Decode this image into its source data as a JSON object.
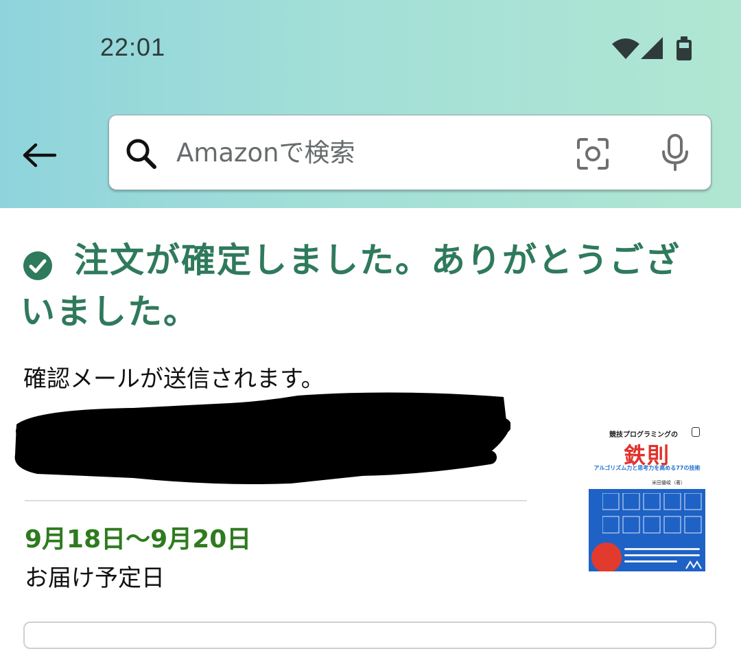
{
  "status_bar": {
    "time": "22:01",
    "icons": [
      "wifi-icon",
      "cellular-signal-icon",
      "battery-icon"
    ]
  },
  "header": {
    "back_icon": "arrow-left-icon",
    "search": {
      "placeholder": "Amazonで検索",
      "icons": [
        "search-icon",
        "camera-icon",
        "microphone-icon"
      ]
    }
  },
  "confirmation": {
    "icon": "check-circle-icon",
    "title": "注文が確定しました。ありがとうございました。",
    "email_note": "確認メールが送信されます。"
  },
  "delivery": {
    "date": "9月18日～9月20日",
    "label": "お届け予定日"
  },
  "product": {
    "series": "競技プログラミングの",
    "title": "鉄則",
    "subtitle": "アルゴリズム力と思考力を高める77の技術",
    "author": "米田優峻（著）"
  },
  "colors": {
    "header_gradient_start": "#8fd4dc",
    "header_gradient_end": "#b0e6d2",
    "confirmation_green": "#2f7a5c",
    "delivery_green": "#2e7b1f",
    "book_title_red": "#e0322c",
    "book_cover_blue": "#1f62c6"
  }
}
